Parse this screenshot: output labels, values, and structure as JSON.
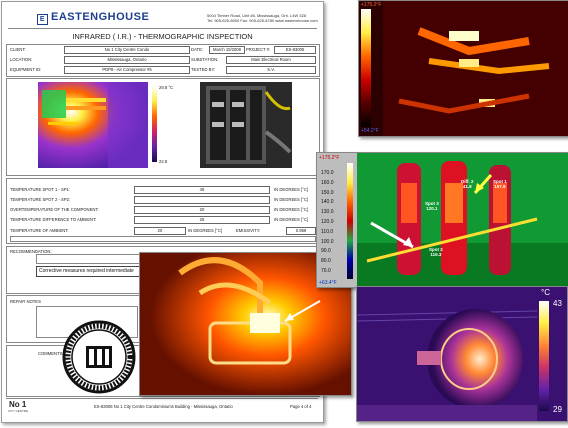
{
  "report": {
    "company": "EASTENGHOUSE",
    "address_lines": [
      "5004 Timber Road, Unit #6, Mississauga, Ont. L4W 3Z8",
      "Tel: 905-625-8000     Fax: 905-625-8780     www.easternhouse.com"
    ],
    "title": "INFRARED ( I.R.) - THERMOGRAPHIC INSPECTION",
    "client_label": "CLIENT:",
    "client_value": "No 1 City Centre Condo",
    "date_label": "DATE:",
    "date_value": "March 10/2008",
    "project_label": "PROJECT #:",
    "project_value": "ES-83005",
    "location_label": "LOCATION:",
    "location_value": "Mississauga, Ontario",
    "substation_label": "SUBSTATION:",
    "substation_value": "Main Electrical Room",
    "equipment_label": "EQUIPMENT ID:",
    "equipment_value": "PDP8 - Air Compressor #5",
    "tested_label": "TESTED BY:",
    "tested_value": "S.V.",
    "ir_scale_max": "29.8 °C",
    "ir_scale_min": "22.8",
    "measurements": [
      {
        "label": "TEMPERATURE SPOT 1 - SP1:",
        "value": "45",
        "unit": "IN DEGREES [°C]"
      },
      {
        "label": "TEMPERATURE SPOT 2 - SP2:",
        "value": "",
        "unit": "IN DEGREES [°C]"
      },
      {
        "label": "OVERTEMPERATURE OF THE COMPONENT:",
        "value": "20",
        "unit": "IN DEGREES [°C]"
      },
      {
        "label": "TEMPERATURE DIFFERENCE TO AMBIENT:",
        "value": "25",
        "unit": "IN DEGREES [°C]"
      }
    ],
    "ambient_label": "TEMPERATURE OF AMBIENT:",
    "ambient_value": "20",
    "ambient_unit": "IN DEGREES [°C]",
    "emissivity_label": "EMISSIVITY:",
    "emissivity_value": "0.969",
    "recommendation_label": "RECOMMENDATION:",
    "recommendation_text": "Corrective measures required intermediate",
    "repair_label": "REPAIR NOTES",
    "comments_label": "COMMENTS",
    "footer_text": "ES-83005 No 1 City Centre Condominiums Building - Mississauga, Ontario",
    "page_label": "Page 4 of 4",
    "footer_logo": "No 1",
    "footer_logo_sub": "CITY CENTRE",
    "stamp_text": "CERTIFIED THERMOGRAPHER"
  },
  "thermal_top_right": {
    "max": "+175.2°F",
    "min": "+54.2°F"
  },
  "thermal_middle": {
    "max": "+175.2°F",
    "min": "+63.4°F",
    "ticks": [
      "170.0",
      "160.0",
      "150.0",
      "140.0",
      "130.0",
      "120.0",
      "110.0",
      "100.0",
      "90.0",
      "80.0",
      "70.0"
    ],
    "spots": [
      {
        "label": "Spot 3",
        "value": "120.1"
      },
      {
        "label": "Diff. 2",
        "value": "41.8"
      },
      {
        "label": "Spot 1",
        "value": "107.9"
      },
      {
        "label": "Spot 2",
        "value": "115.3"
      }
    ]
  },
  "thermal_bottom": {
    "unit": "°C",
    "max": "43",
    "min": "29"
  },
  "colors": {
    "brand": "#1d3f8f",
    "hot": "#ff3300",
    "cold": "#00c040"
  }
}
